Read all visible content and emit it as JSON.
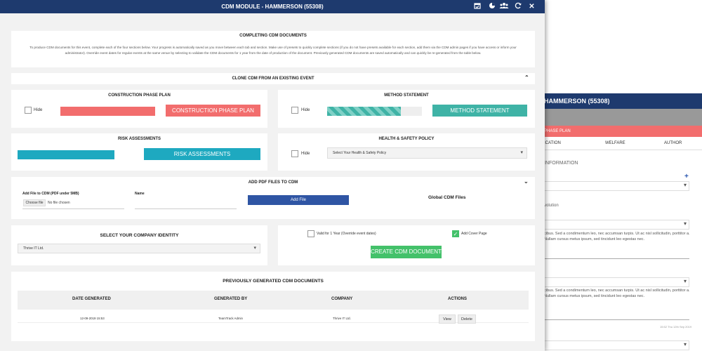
{
  "background_window": {
    "title": "HAMMERSON (55308)",
    "section_label": "PHASE PLAN",
    "tabs": [
      "ICATION",
      "WELFARE",
      "AUTHOR"
    ],
    "info_label": "INFORMATION",
    "field_label": "volution",
    "lorem1": "cibus. Sed a condimentum leo, nec accumsan turpis. Ut ac nisl sollicitudin, porttitor a. Nullam cursus metus ipsum, sed tincidunt leo egestas nec.",
    "lorem2": "cibus. Sed a condimentum leo, nec accumsan turpis. Ut ac nisl sollicitudin, porttitor a. Nullam cursus metus ipsum, sed tincidunt leo egestas nec.",
    "timestamp": "15:52 Thu 12th Sep 2019",
    "plus_icon": "plus-icon"
  },
  "modal": {
    "title": "CDM MODULE - HAMMERSON (55308)",
    "toolbar_icons": [
      "calendar-check-icon",
      "pie-chart-icon",
      "users-icon",
      "refresh-icon",
      "close-icon"
    ],
    "completing": {
      "title": "COMPLETING CDM DOCUMENTS",
      "text": "To produce CDM documents for this event, complete each of the four sections below. Your progress is automatically saved as you move between each tab and section. Make use of presets to quickly complete sections (if you do not have presets available for each section, add them via the CDM admin pages if you have access or inform your administrator). Override event dates for regular events at the same venue by selecting to validate the CDM documents for 1 year from the date of production of the document. Previously generated CDM documents are saved automatically and can quickly be re-generated from the table below."
    },
    "clone": {
      "title": "CLONE CDM FROM AN EXISTING EVENT"
    },
    "construction": {
      "title": "CONSTRUCTION PHASE PLAN",
      "hide_label": "Hide",
      "button": "CONSTRUCTION PHASE PLAN",
      "progress": 1.0,
      "color": "#f26d6d"
    },
    "method": {
      "title": "METHOD STATEMENT",
      "hide_label": "Hide",
      "button": "METHOD STATEMENT",
      "progress": 0.78,
      "color": "#3fb3a6"
    },
    "risk": {
      "title": "RISK ASSESSMENTS",
      "button": "RISK ASSESSMENTS",
      "progress": 1.0,
      "color": "#1ea9c0"
    },
    "health": {
      "title": "HEALTH & SAFETY POLICY",
      "hide_label": "Hide",
      "select_value": "Select Your Health & Safety Policy"
    },
    "pdf": {
      "title": "ADD PDF FILES TO CDM",
      "file_label": "Add File to CDM (PDF under 5MB)",
      "choose_button": "Choose file",
      "no_file": "No file chosen",
      "name_label": "Name",
      "add_button": "Add File",
      "global_label": "Global CDM Files"
    },
    "company": {
      "title": "SELECT YOUR COMPANY IDENTITY",
      "value": "Thrive IT Ltd."
    },
    "options": {
      "valid_label": "Valid for 1 Year (Override event dates)",
      "valid_checked": false,
      "cover_label": "Add Cover Page",
      "cover_checked": true,
      "create_button": "CREATE CDM DOCUMENT"
    },
    "previous": {
      "title": "PREVIOUSLY GENERATED CDM DOCUMENTS",
      "headers": [
        "DATE GENERATED",
        "GENERATED BY",
        "COMPANY",
        "ACTIONS"
      ],
      "rows": [
        {
          "date": "12-09-2019 15:53",
          "by": "TeamTrack Admin",
          "company": "Thrive IT Ltd.",
          "view": "View",
          "delete": "Delete"
        }
      ]
    }
  },
  "colors": {
    "navy": "#1e3a6e",
    "red": "#f26d6d",
    "teal": "#3fb3a6",
    "cyan": "#1ea9c0",
    "blue": "#2f55a4",
    "green": "#43c16a"
  }
}
